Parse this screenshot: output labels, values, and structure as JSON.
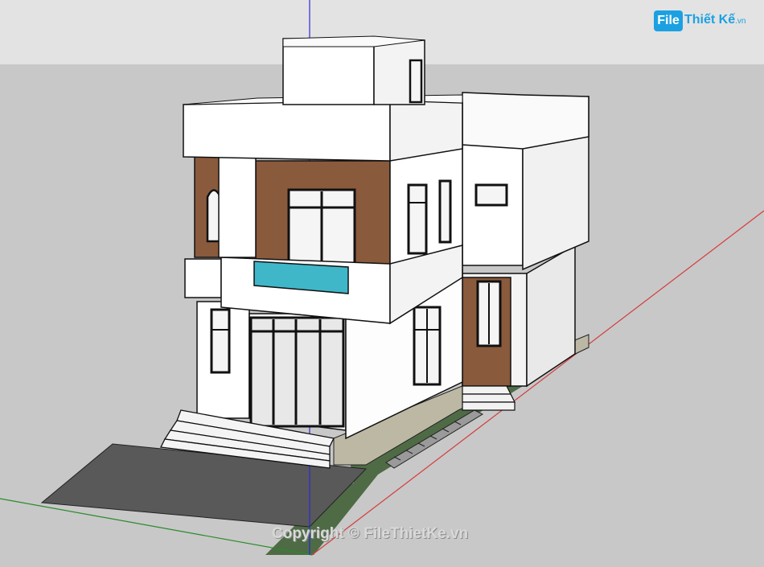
{
  "watermark": {
    "logo_file": "File",
    "logo_rest": "Thiết Kế",
    "logo_domain": ".vn",
    "copyright": "Copyright © FileThietKe.vn"
  },
  "colors": {
    "sky": "#e3e3e3",
    "ground": "#c8c8c8",
    "wall": "#ffffff",
    "wood": "#8a5a3c",
    "glass_rail": "#3fb7c9",
    "driveway": "#595959",
    "grass": "#4e6b45",
    "axis_red": "#d43c3c",
    "axis_green": "#2a8a2a",
    "axis_blue": "#2b2bd6",
    "logo_blue": "#1ba1e2"
  },
  "scene": {
    "model": "two-story-house",
    "axes": [
      "red-axis",
      "green-axis",
      "blue-axis"
    ]
  }
}
